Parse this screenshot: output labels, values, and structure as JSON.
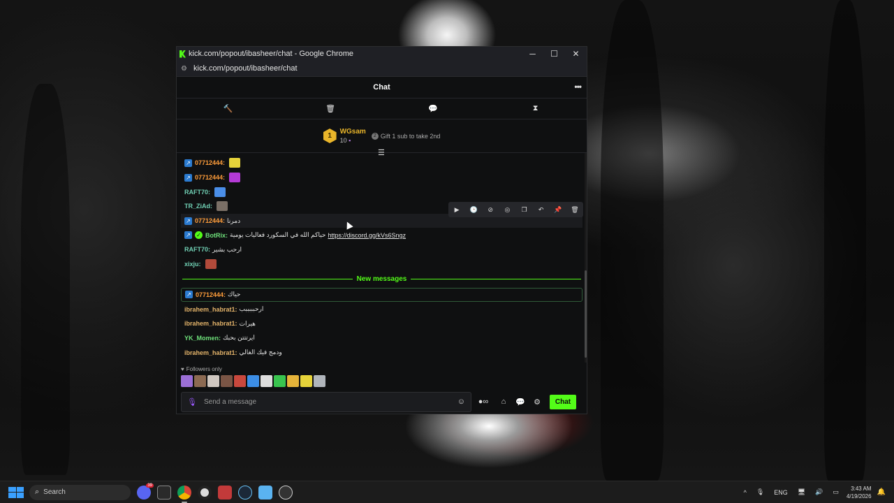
{
  "window": {
    "title": "kick.com/popout/ibasheer/chat - Google Chrome",
    "address": "kick.com/popout/ibasheer/chat",
    "controls": {
      "minimize": "─",
      "maximize": "☐",
      "close": "✕"
    }
  },
  "chat": {
    "header_title": "Chat",
    "more_label": "•••",
    "mod_tools": [
      {
        "icon": "gavel-icon",
        "glyph": "🔨"
      },
      {
        "icon": "trash-icon",
        "glyph": "🗑"
      },
      {
        "icon": "chat-bubble-icon",
        "glyph": "💬"
      },
      {
        "icon": "hourglass-icon",
        "glyph": "⧗"
      }
    ],
    "leaderboard": {
      "rank": "1",
      "username": "WGsam",
      "count": "10",
      "gift_text": "Gift 1 sub to take 2nd"
    },
    "messages": [
      {
        "user": "07712444",
        "sep": ":",
        "text": "",
        "color": "orange",
        "badge": "sub",
        "emote": "#e6d33a"
      },
      {
        "user": "07712444",
        "sep": ":",
        "text": "",
        "color": "orange",
        "badge": "sub",
        "emote": "#b43ad6"
      },
      {
        "user": "RAFT70",
        "sep": ":",
        "text": "",
        "color": "teal",
        "badge": "",
        "emote": "#4a8ee8"
      },
      {
        "user": "TR_ZiAd",
        "sep": ":",
        "text": "",
        "color": "teal",
        "badge": "",
        "emote": "#7a6f66"
      },
      {
        "user": "07712444",
        "sep": ":",
        "text": "دمرنا",
        "color": "orange",
        "badge": "sub",
        "emote": ""
      },
      {
        "user": "BotRix",
        "sep": ":",
        "text": "حياكم الله في السكورد فعاليات يومية",
        "color": "green",
        "badge": "sub",
        "verified": true,
        "link": "https://discord.gg/kVs6Sngz"
      },
      {
        "user": "RAFT70",
        "sep": ":",
        "text": "ارحب بشير",
        "color": "teal",
        "badge": "",
        "emote": ""
      },
      {
        "user": "xixju",
        "sep": ":",
        "text": "",
        "color": "teal",
        "badge": "",
        "emote": "#b24a3a"
      }
    ],
    "new_messages_label": "New messages",
    "new_messages": [
      {
        "user": "07712444",
        "sep": ":",
        "text": "حياك",
        "color": "orange",
        "badge": "sub"
      },
      {
        "user": "ibrahem_habrat1",
        "sep": ":",
        "text": "ارحبببببب",
        "color": "tan",
        "badge": ""
      },
      {
        "user": "ibrahem_habrat1",
        "sep": ":",
        "text": "هيرات",
        "color": "tan",
        "badge": ""
      },
      {
        "user": "YK_Momen",
        "sep": ":",
        "text": "ايرتتتن بحبك",
        "color": "green",
        "badge": ""
      },
      {
        "user": "ibrahem_habrat1",
        "sep": ":",
        "text": "ودمج فيك الغالي",
        "color": "tan",
        "badge": ""
      }
    ],
    "message_actions": [
      {
        "name": "play-icon",
        "glyph": "▶"
      },
      {
        "name": "clock-icon",
        "glyph": "🕒"
      },
      {
        "name": "slash-icon",
        "glyph": "⊘"
      },
      {
        "name": "reply-icon",
        "glyph": "◎"
      },
      {
        "name": "copy-icon",
        "glyph": "❐"
      },
      {
        "name": "undo-icon",
        "glyph": "↶"
      },
      {
        "name": "pin-icon",
        "glyph": "📌"
      },
      {
        "name": "delete-icon",
        "glyph": "🗑"
      }
    ],
    "followers_only": "Followers only",
    "input_placeholder": "Send a message",
    "send_label": "Chat",
    "emote_colors": [
      "#9b6fd6",
      "#8c6a52",
      "#cfc7c0",
      "#7a5545",
      "#c9483d",
      "#3c8ee6",
      "#dddddd",
      "#39c44f",
      "#e6b43a",
      "#e6d33a",
      "#b0b5bb"
    ]
  },
  "taskbar": {
    "search_label": "Search",
    "tray_lang": "ENG",
    "time": "3:43 AM",
    "date": "4/19/2026",
    "discord_badge": "39"
  },
  "colors": {
    "kick_green": "#53fc18",
    "orange_user": "#ff9d3a"
  }
}
